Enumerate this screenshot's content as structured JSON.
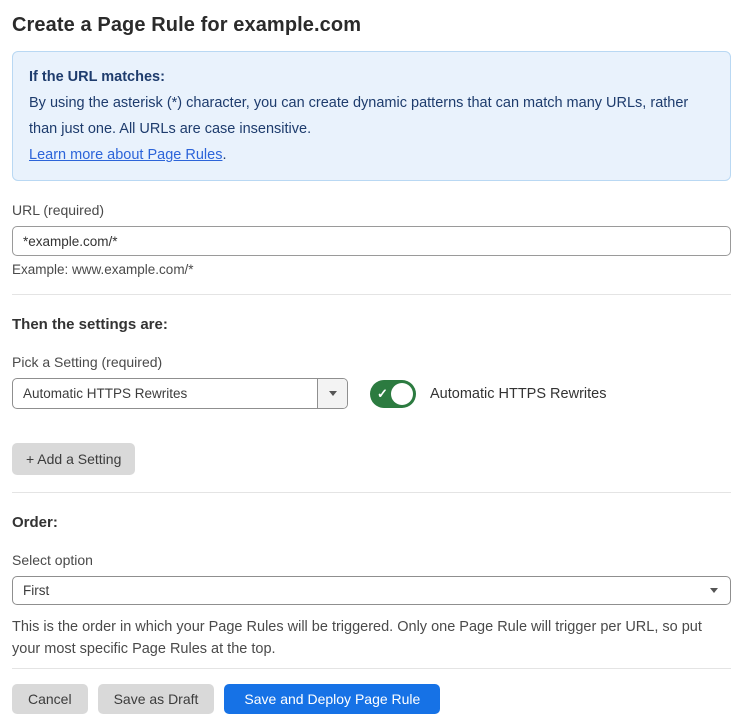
{
  "page": {
    "title": "Create a Page Rule for example.com"
  },
  "info_box": {
    "heading": "If the URL matches:",
    "body": "By using the asterisk (*) character, you can create dynamic patterns that can match many URLs, rather than just one. All URLs are case insensitive.",
    "link_label": "Learn more about Page Rules",
    "link_suffix": "."
  },
  "url_field": {
    "label": "URL (required)",
    "value": "*example.com/*",
    "helper": "Example: www.example.com/*"
  },
  "settings_section": {
    "heading": "Then the settings are:",
    "picker_label": "Pick a Setting (required)",
    "picker_value": "Automatic HTTPS Rewrites",
    "toggle_state": "on",
    "toggle_check_glyph": "✓",
    "toggle_label": "Automatic HTTPS Rewrites",
    "add_setting_button": "+ Add a Setting"
  },
  "order_section": {
    "heading": "Order:",
    "select_label": "Select option",
    "select_value": "First",
    "helper": "This is the order in which your Page Rules will be triggered. Only one Page Rule will trigger per URL, so put your most specific Page Rules at the top."
  },
  "footer": {
    "cancel_label": "Cancel",
    "save_draft_label": "Save as Draft",
    "save_deploy_label": "Save and Deploy Page Rule"
  },
  "colors": {
    "accent_blue": "#1672e6",
    "toggle_green_on": "#2c7b40",
    "info_background": "#e9f2fc",
    "info_border": "#b9d8f3",
    "info_text": "#1e3c6d",
    "link_blue": "#2c64d9",
    "button_gray": "#d9d9d9"
  }
}
